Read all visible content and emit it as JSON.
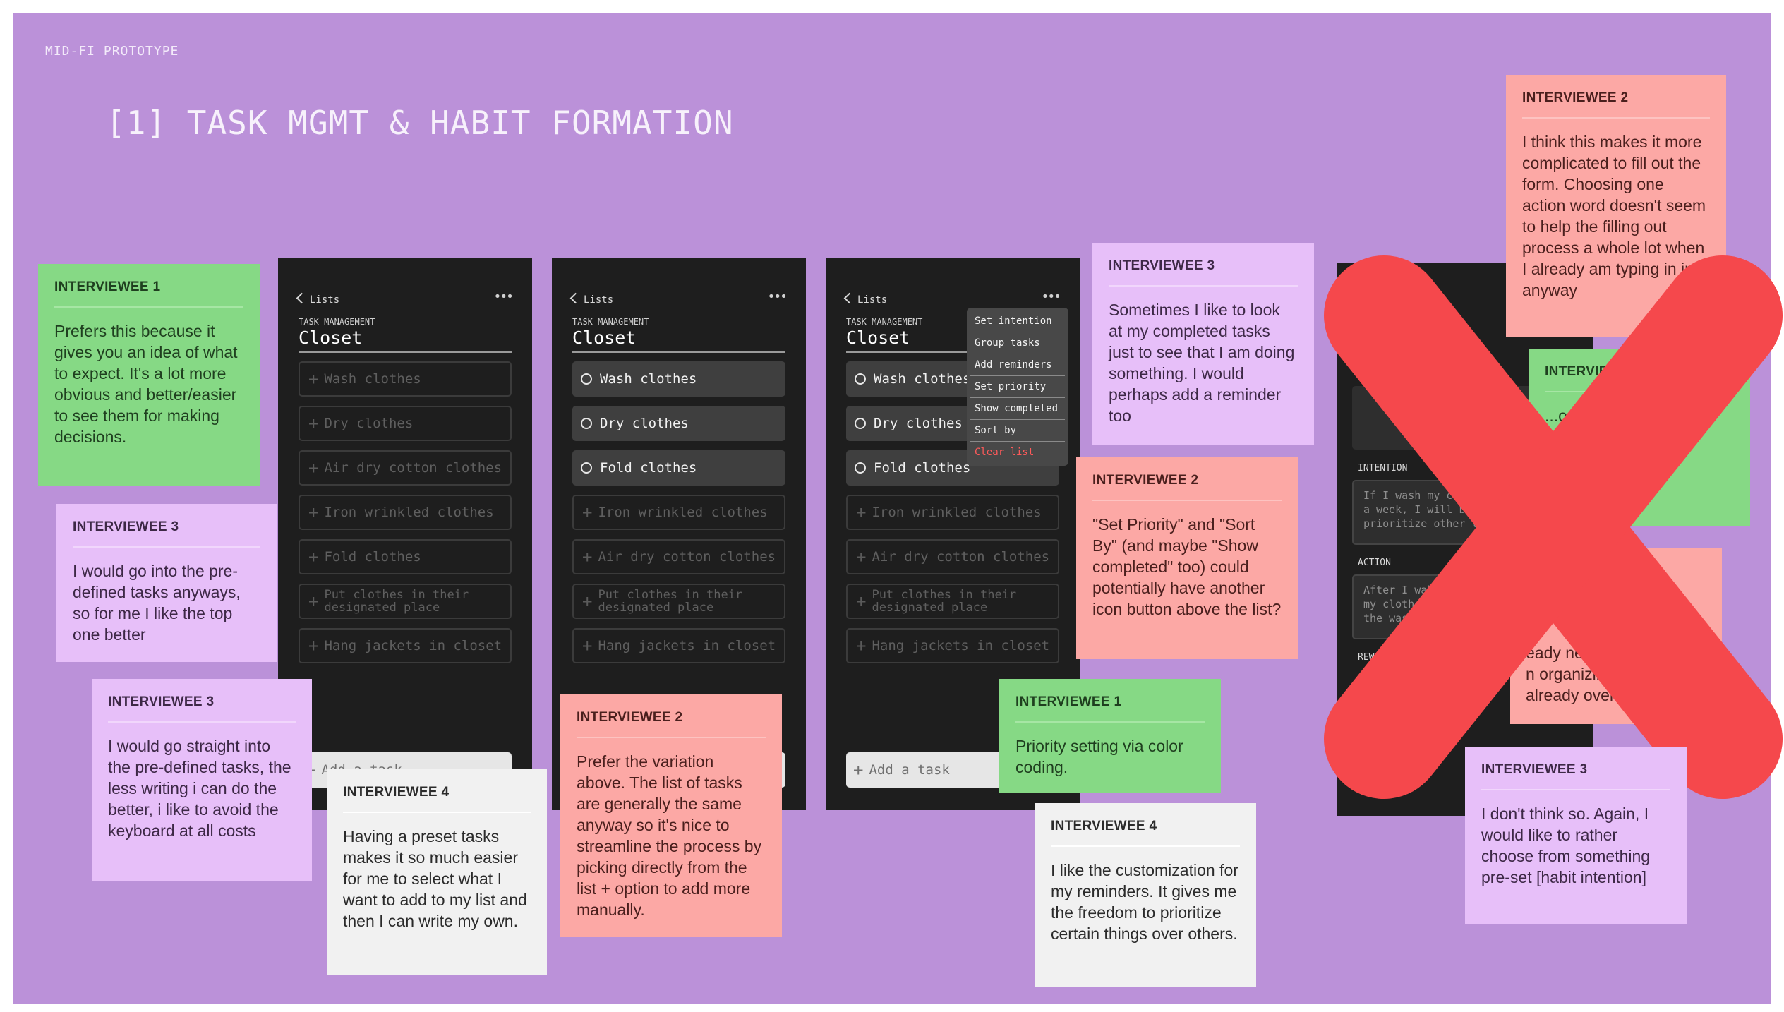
{
  "board": {
    "kicker": "MID-FI PROTOTYPE",
    "title": "[1] TASK MGMT & HABIT FORMATION"
  },
  "phones": {
    "back_label": "Lists",
    "more_icon": "•••",
    "kicker": "TASK MANAGEMENT",
    "list_name": "Closet",
    "add_task": "Add a task",
    "tasks": {
      "wash": "Wash clothes",
      "dry": "Dry clothes",
      "air_dry": "Air dry cotton clothes",
      "iron": "Iron wrinkled clothes",
      "fold": "Fold clothes",
      "put_away_1": "Put clothes in their",
      "put_away_2": "designated place",
      "hang": "Hang jackets in closet"
    },
    "menu": [
      "Set intention",
      "Group tasks",
      "Add reminders",
      "Set priority",
      "Show completed",
      "Sort by",
      "Clear list"
    ],
    "form": {
      "intention_label": "INTENTION",
      "intention_text": "If I wash my cl\na week, I will be\nprioritize other thi",
      "action_label": "ACTION",
      "action_text": "After I wak\nmy clothe\nthe was",
      "reward_label": "REW"
    }
  },
  "notes": [
    {
      "who": "INTERVIEWEE 1",
      "text": "Prefers this because it gives you an idea of what to expect. It's a lot more obvious and better/easier to see them for making decisions."
    },
    {
      "who": "INTERVIEWEE 3",
      "text": "I would go into the pre-defined tasks anyways, so for me I like the top one better"
    },
    {
      "who": "INTERVIEWEE 3",
      "text": "I would go straight into the pre-defined tasks, the less writing i can do the better, i like to avoid the keyboard at all costs"
    },
    {
      "who": "INTERVIEWEE 4",
      "text": "Having a preset tasks makes it so much easier for me to select what I want to add to my list and then I can write my own."
    },
    {
      "who": "INTERVIEWEE 2",
      "text": "Prefer the variation above. The list of tasks are generally the same anyway so it's nice to streamline the process by picking directly from the list + option to add more manually."
    },
    {
      "who": "INTERVIEWEE 3",
      "text": "Sometimes I like to look at my completed tasks just to see that I am doing something. I would perhaps add a reminder too"
    },
    {
      "who": "INTERVIEWEE 2",
      "text": "\"Set Priority\" and \"Sort By\" (and maybe \"Show completed\" too) could potentially have another icon button above the list?"
    },
    {
      "who": "INTERVIEWEE 1",
      "text": "Priority setting via color coding."
    },
    {
      "who": "INTERVIEWEE 4",
      "text": "I like the customization for my reminders. It gives me the freedom to prioritize certain things over others."
    },
    {
      "who": "INTERVIEWEE 2",
      "text": "I think this makes it more complicated to fill out the form. Choosing one action word doesn't seem to help the filling out process a whole lot when I already am typing in info anyway"
    },
    {
      "who": "INTERVIEWEE 1",
      "text": "...onall"
    },
    {
      "who": "INTERVIEWEE 3",
      "text": "I don't think so. Again, I would like to rather choose from something pre-set [habit intention]"
    }
  ],
  "partial_note": {
    "line1": "eady ne",
    "line2": "n organizing",
    "line3": "already overwhelm"
  },
  "colors": {
    "board": "#bb91d9",
    "green": "#86d985",
    "lilac": "#e7bff9",
    "pink": "#fca8a5",
    "white": "#f1f1f1",
    "x": "#f5484c"
  }
}
